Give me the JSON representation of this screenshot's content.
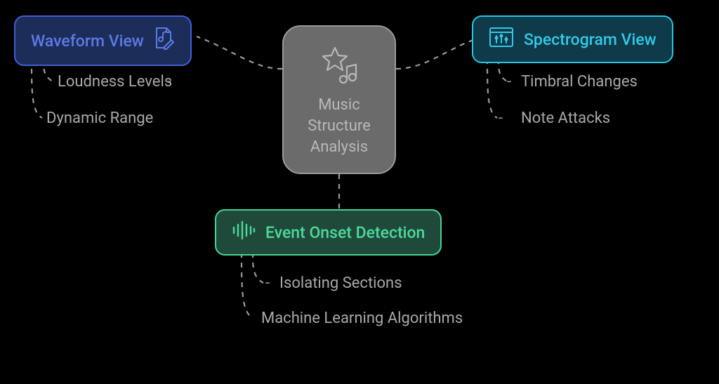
{
  "center": {
    "title": "Music Structure Analysis"
  },
  "branches": {
    "waveform": {
      "label": "Waveform View",
      "leaves": [
        "Loudness Levels",
        "Dynamic Range"
      ]
    },
    "spectrogram": {
      "label": "Spectrogram View",
      "leaves": [
        "Timbral Changes",
        "Note Attacks"
      ]
    },
    "onset": {
      "label": "Event Onset Detection",
      "leaves": [
        "Isolating Sections",
        "Machine Learning Algorithms"
      ]
    }
  },
  "colors": {
    "waveform": "#3f5fd4",
    "spectrogram": "#2bc4e0",
    "onset": "#45d496",
    "neutral": "#9a9a9a"
  }
}
